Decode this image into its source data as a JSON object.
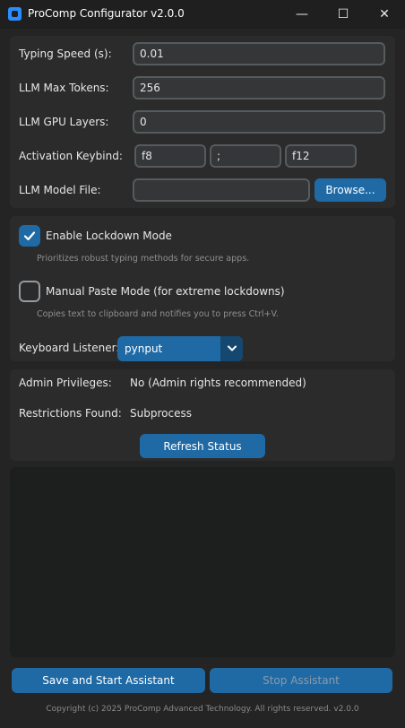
{
  "window": {
    "title": "ProComp Configurator v2.0.0",
    "icon": "app-logo-icon",
    "minimize_glyph": "—",
    "maximize_glyph": "☐",
    "close_glyph": "✕"
  },
  "settings": {
    "typing_speed": {
      "label": "Typing Speed (s):",
      "value": "0.01"
    },
    "max_tokens": {
      "label": "LLM Max Tokens:",
      "value": "256"
    },
    "gpu_layers": {
      "label": "LLM GPU Layers:",
      "value": "0"
    },
    "keybind": {
      "label": "Activation Keybind:",
      "keys": [
        "f8",
        ";",
        "f12"
      ]
    },
    "model_file": {
      "label": "LLM Model File:",
      "value": "",
      "browse_label": "Browse..."
    }
  },
  "options": {
    "lockdown": {
      "label": "Enable Lockdown Mode",
      "checked": true,
      "hint": "Prioritizes robust typing methods for secure apps."
    },
    "manual_paste": {
      "label": "Manual Paste Mode (for extreme lockdowns)",
      "checked": false,
      "hint": "Copies text to clipboard and notifies you to press Ctrl+V."
    },
    "listener": {
      "label": "Keyboard Listener:",
      "value": "pynput"
    }
  },
  "status": {
    "admin_label": "Admin Privileges:",
    "admin_value": "No (Admin rights recommended)",
    "restrictions_label": "Restrictions Found:",
    "restrictions_value": "Subprocess",
    "refresh_label": "Refresh Status"
  },
  "log": {
    "text": ""
  },
  "actions": {
    "start_label": "Save and Start Assistant",
    "stop_label": "Stop Assistant",
    "stop_disabled": true
  },
  "footer": "Copyright (c) 2025 ProComp Advanced Technology. All rights reserved. v2.0.0",
  "colors": {
    "accent": "#1f6aa5",
    "accent_dark": "#144870",
    "background": "#242424",
    "panel": "#2b2b2b",
    "entry": "#343638",
    "entry_border": "#565b5e"
  }
}
